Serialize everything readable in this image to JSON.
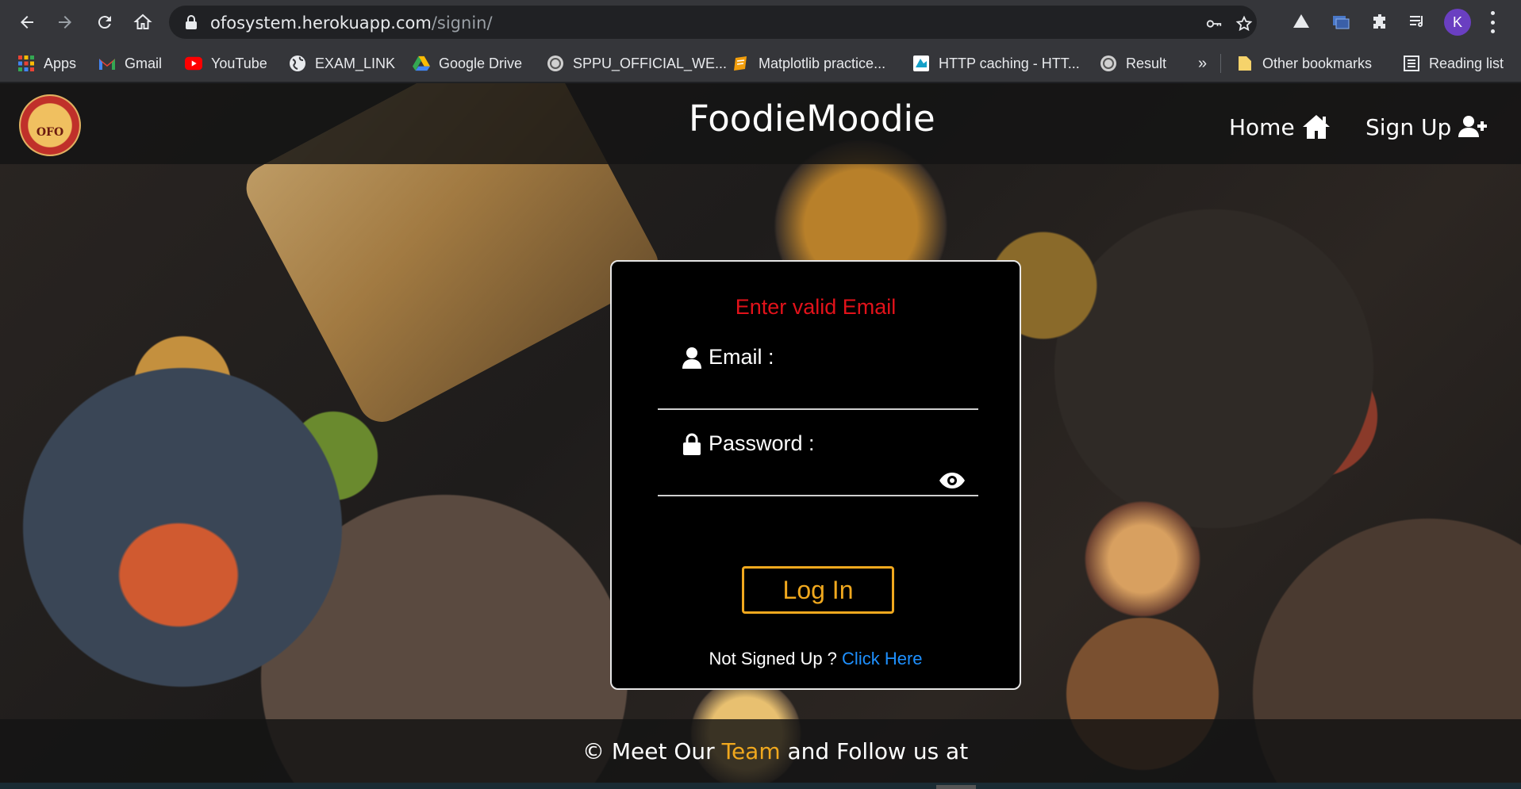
{
  "browser": {
    "url_host": "ofosystem.herokuapp.com",
    "url_path": "/signin/",
    "profile_initial": "K"
  },
  "bookmarks": {
    "items": [
      {
        "label": "Apps",
        "icon": "apps-grid-icon"
      },
      {
        "label": "Gmail",
        "icon": "gmail-icon"
      },
      {
        "label": "YouTube",
        "icon": "youtube-icon"
      },
      {
        "label": "EXAM_LINK",
        "icon": "globe-icon"
      },
      {
        "label": "Google Drive",
        "icon": "google-drive-icon"
      },
      {
        "label": "SPPU_OFFICIAL_WE...",
        "icon": "site-icon"
      },
      {
        "label": "Matplotlib practice...",
        "icon": "notebook-icon"
      },
      {
        "label": "HTTP caching - HTT...",
        "icon": "mdn-icon"
      },
      {
        "label": "Result",
        "icon": "site-icon"
      }
    ],
    "overflow": "»",
    "other": "Other bookmarks",
    "reading_list": "Reading list"
  },
  "site": {
    "brand": "FoodieMoodie",
    "logo_text": "OFO",
    "nav": {
      "home": "Home",
      "signup": "Sign Up"
    }
  },
  "login": {
    "error": "Enter valid Email",
    "email_label": "Email :",
    "password_label": "Password :",
    "button": "Log In",
    "signup_prompt": "Not Signed Up ?",
    "signup_link": "Click Here"
  },
  "footer": {
    "prefix": "© Meet Our",
    "team": "Team",
    "suffix": "and Follow us at"
  },
  "colors": {
    "error": "#e2121a",
    "accent": "#f0a81e",
    "link": "#1e90ff"
  }
}
